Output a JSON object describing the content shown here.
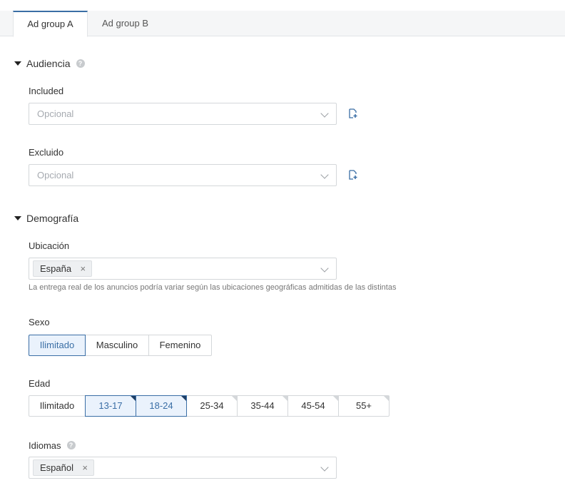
{
  "tabs": [
    {
      "label": "Ad group A"
    },
    {
      "label": "Ad group B"
    }
  ],
  "audience": {
    "title": "Audiencia",
    "included_label": "Included",
    "included_placeholder": "Opcional",
    "excluded_label": "Excluido",
    "excluded_placeholder": "Opcional"
  },
  "demographics": {
    "title": "Demografía",
    "location_label": "Ubicación",
    "location_chip": "España",
    "location_hint": "La entrega real de los anuncios podría variar según las ubicaciones geográficas admitidas de las distintas",
    "gender_label": "Sexo",
    "gender_options": [
      "Ilimitado",
      "Masculino",
      "Femenino"
    ],
    "gender_selected": "Ilimitado",
    "age_label": "Edad",
    "age_options": [
      "Ilimitado",
      "13-17",
      "18-24",
      "25-34",
      "35-44",
      "45-54",
      "55+"
    ],
    "age_selected": [
      "13-17",
      "18-24"
    ],
    "language_label": "Idiomas",
    "language_chip": "Español"
  },
  "icons": {
    "chip_close": "×",
    "help": "?"
  },
  "colors": {
    "accent": "#3a6ea5",
    "selected_bg": "#eaf2fc"
  }
}
